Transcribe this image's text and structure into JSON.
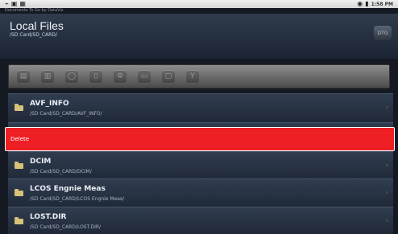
{
  "status_bar": {
    "left_icons": [
      "usb-icon",
      "sd-icon",
      "notification-icon"
    ],
    "right_icons": [
      "wifi-icon",
      "battery-icon"
    ],
    "time": "1:58 PM"
  },
  "app_name": "Documents To Go by DataViz",
  "header": {
    "title": "Local Files",
    "path": "/SD Card/SD_CARD/"
  },
  "toolbar": {
    "icons": [
      "doc-icon",
      "sheet-icon",
      "search-icon",
      "delete-icon",
      "settings-icon",
      "folder-icon",
      "document-icon",
      "filter-icon"
    ]
  },
  "files": [
    {
      "name": "AVF_INFO",
      "path": "/SD Card/SD_CARD/AVF_INFO/"
    },
    {
      "name": "",
      "path": ""
    },
    {
      "name": "DCIM",
      "path": "/SD Card/SD_CARD/DCIM/"
    },
    {
      "name": "LCOS Engnie Meas",
      "path": "/SD Card/SD_CARD/LCOS Engnie Meas/"
    },
    {
      "name": "LOST.DIR",
      "path": "/SD Card/SD_CARD/LOST.DIR/"
    }
  ],
  "context_menu": {
    "label": "Delete",
    "color": "#ed1f24"
  }
}
